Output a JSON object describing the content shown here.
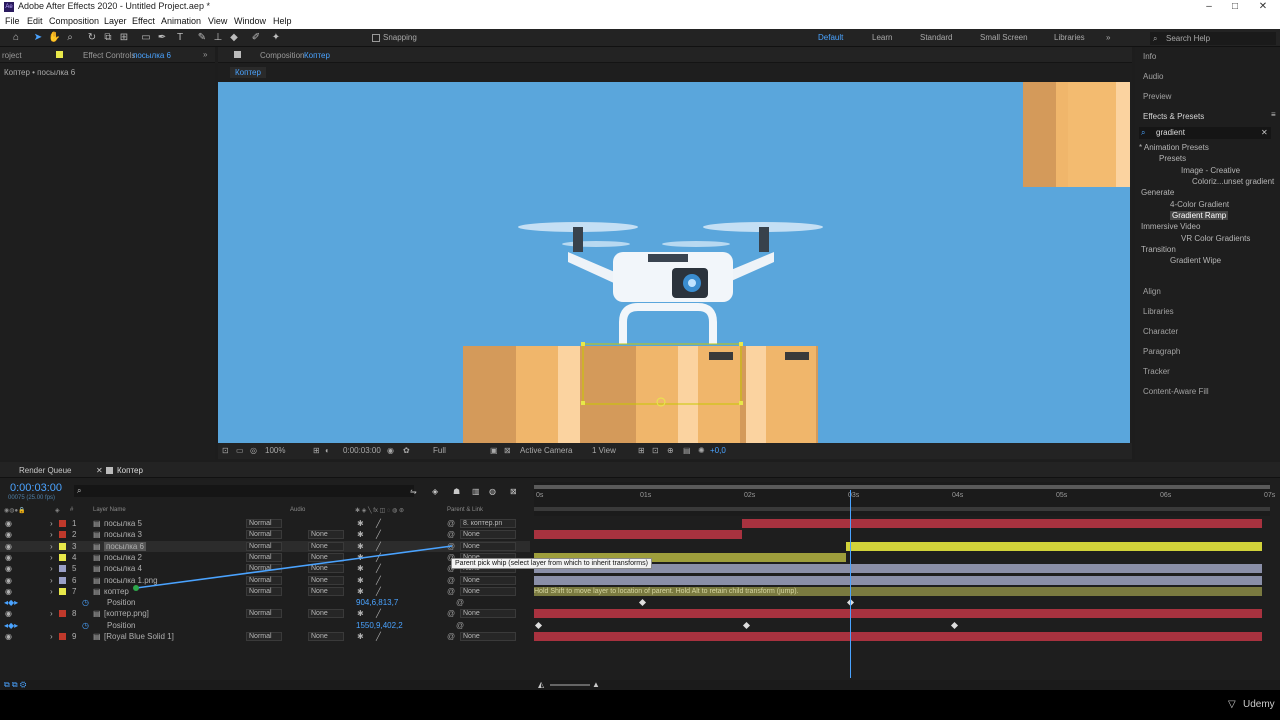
{
  "app": {
    "title": "Adobe After Effects 2020 - Untitled Project.aep *",
    "logo": "Ae"
  },
  "menu": [
    "File",
    "Edit",
    "Composition",
    "Layer",
    "Effect",
    "Animation",
    "View",
    "Window",
    "Help"
  ],
  "toolbar": {
    "snapping": "Snapping",
    "workspaces": [
      "Default",
      "Learn",
      "Standard",
      "Small Screen",
      "Libraries"
    ],
    "search_placeholder": "Search Help"
  },
  "left_panel": {
    "tab_project": "roject",
    "tab_effect_controls": "Effect Controls",
    "tab_effect_target": "посылка 6",
    "subtitle": "Коптер • посылка 6"
  },
  "comp_panel": {
    "tab_label": "Composition",
    "tab_name": "Коптер",
    "subtab": "Коптер",
    "zoom": "100%",
    "time": "0:00:03:00",
    "resolution": "Full",
    "camera": "Active Camera",
    "views": "1 View",
    "exposure": "+0,0"
  },
  "right_panel": {
    "items_top": [
      "Info",
      "Audio",
      "Preview"
    ],
    "effects_title": "Effects & Presets",
    "search_value": "gradient",
    "tree": [
      {
        "label": "* Animation Presets",
        "indent": 0
      },
      {
        "label": "Presets",
        "indent": 1
      },
      {
        "label": "Image - Creative",
        "indent": 2
      },
      {
        "label": "Coloriz...unset gradient",
        "indent": 3
      },
      {
        "label": "Generate",
        "indent": 0
      },
      {
        "label": "4-Color Gradient",
        "indent": 1
      },
      {
        "label": "Gradient Ramp",
        "indent": 1
      },
      {
        "label": "Immersive Video",
        "indent": 0
      },
      {
        "label": "VR Color Gradients",
        "indent": 1
      },
      {
        "label": "Transition",
        "indent": 0
      },
      {
        "label": "Gradient Wipe",
        "indent": 1
      }
    ],
    "items_bottom": [
      "Align",
      "Libraries",
      "Character",
      "Paragraph",
      "Tracker",
      "Content-Aware Fill"
    ]
  },
  "timeline": {
    "tab_render": "Render Queue",
    "tab_comp": "Коптер",
    "timecode": "0:00:03:00",
    "frames": "00075 (25.00 fps)",
    "col_layer_name": "Layer Name",
    "col_audio": "Audio",
    "col_parent": "Parent & Link",
    "ruler": [
      "0s",
      "01s",
      "02s",
      "03s",
      "04s",
      "05s",
      "06s",
      "07s"
    ],
    "current_time_sec": 3,
    "duration_sec": 7,
    "rows": [
      {
        "num": "1",
        "name": "посылка 5",
        "color": "#c0392b",
        "mode": "Normal",
        "trk": "",
        "parent": "8. коптер.pn",
        "bar": [
          2,
          7
        ],
        "barcolor": "#a8323f"
      },
      {
        "num": "2",
        "name": "посылка 3",
        "color": "#c0392b",
        "mode": "Normal",
        "trk": "None",
        "parent": "None",
        "bar": [
          0,
          2
        ],
        "barcolor": "#a8323f"
      },
      {
        "num": "3",
        "name": "посылка 6",
        "color": "#e8e84a",
        "mode": "Normal",
        "trk": "None",
        "parent": "None",
        "bar": [
          3,
          7
        ],
        "barcolor": "#d1d23a"
      },
      {
        "num": "4",
        "name": "посылка 2",
        "color": "#e8e84a",
        "mode": "Normal",
        "trk": "None",
        "parent": "None",
        "bar": [
          0,
          3
        ],
        "barcolor": "#9e9e3c"
      },
      {
        "num": "5",
        "name": "посылка 4",
        "color": "#9aa0c8",
        "mode": "Normal",
        "trk": "None",
        "parent": "None",
        "bar": [
          0,
          7
        ],
        "barcolor": "#8a8fa8"
      },
      {
        "num": "6",
        "name": "посылка 1.png",
        "color": "#9aa0c8",
        "mode": "Normal",
        "trk": "None",
        "parent": "None",
        "bar": [
          0,
          7
        ],
        "barcolor": "#8a8fa8"
      },
      {
        "num": "7",
        "name": "коптер",
        "color": "#e8e84a",
        "mode": "Normal",
        "trk": "None",
        "parent": "None",
        "bar": [
          0,
          7
        ],
        "barcolor": "#7a7a40"
      },
      {
        "num": "",
        "name": "Position",
        "color": "",
        "mode": "",
        "trk": "",
        "parent": "",
        "value": "904,6,813,7"
      },
      {
        "num": "8",
        "name": "[коптер.png]",
        "color": "#c0392b",
        "mode": "Normal",
        "trk": "None",
        "parent": "None",
        "bar": [
          0,
          7
        ],
        "barcolor": "#a8323f"
      },
      {
        "num": "",
        "name": "Position",
        "color": "",
        "mode": "",
        "trk": "",
        "parent": "",
        "value": "1550,9,402,2"
      },
      {
        "num": "9",
        "name": "[Royal Blue Solid 1]",
        "color": "#c0392b",
        "mode": "Normal",
        "trk": "None",
        "parent": "None",
        "bar": [
          0,
          7
        ],
        "barcolor": "#a8323f"
      }
    ],
    "tooltip": "Parent pick whip (select layer from which to inherit transforms)",
    "hint": "Hold Shift to move layer to location of parent. Hold Alt to retain child transform (jump)."
  },
  "watermark": "Udemy",
  "colors": {
    "accent": "#2d8ceb",
    "sky": "#5aa6dc",
    "box": "#f0b66b"
  }
}
